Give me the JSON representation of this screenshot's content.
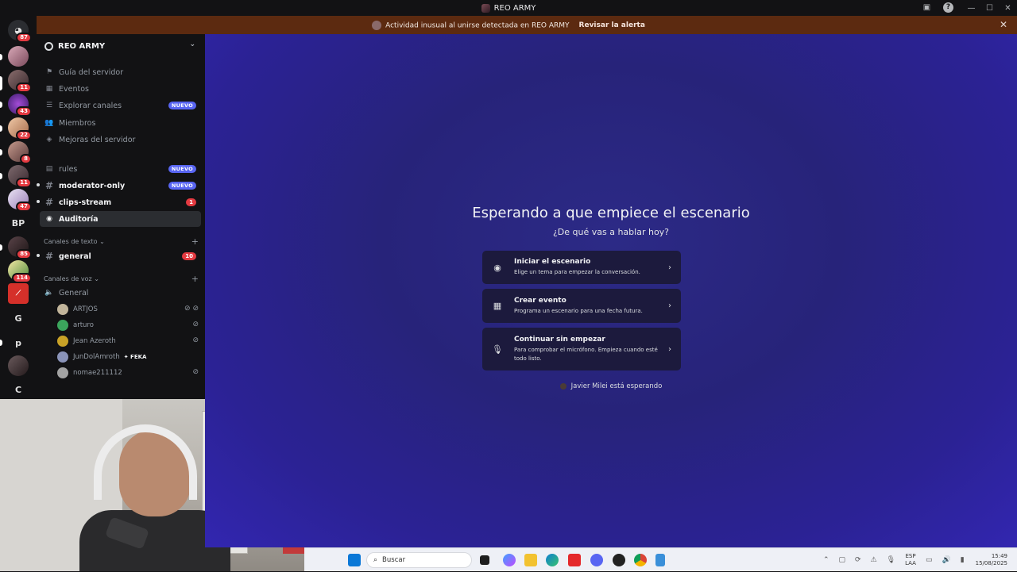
{
  "window": {
    "title": "REO ARMY"
  },
  "alert": {
    "message": "Actividad inusual al unirse detectada en REO ARMY",
    "action": "Revisar la alerta"
  },
  "guilds": [
    {
      "badge": "87"
    },
    {
      "badge": ""
    },
    {
      "badge": "11"
    },
    {
      "badge": "43"
    },
    {
      "badge": "22"
    },
    {
      "badge": "8"
    },
    {
      "badge": "11"
    },
    {
      "badge": "47"
    },
    {
      "label": "BP",
      "badge": ""
    },
    {
      "badge": "85"
    },
    {
      "badge": "114"
    },
    {
      "badge": ""
    },
    {
      "label": "G",
      "badge": ""
    },
    {
      "label": "p",
      "badge": ""
    },
    {
      "badge": ""
    },
    {
      "label": "C",
      "badge": ""
    }
  ],
  "server": {
    "name": "REO ARMY",
    "menu": [
      {
        "label": "Guía del servidor",
        "icon": "signpost-icon"
      },
      {
        "label": "Eventos",
        "icon": "calendar-icon"
      },
      {
        "label": "Explorar canales",
        "icon": "browse-icon",
        "badge": "NUEVO"
      },
      {
        "label": "Miembros",
        "icon": "members-icon"
      },
      {
        "label": "Mejoras del servidor",
        "icon": "boost-icon"
      }
    ],
    "channels": [
      {
        "label": "rules",
        "badge": "NUEVO"
      },
      {
        "label": "moderator-only",
        "badge": "NUEVO"
      },
      {
        "label": "clips-stream",
        "count": "1"
      },
      {
        "label": "Auditoría"
      }
    ],
    "text_category": "Canales de texto",
    "text_channels": [
      {
        "label": "general",
        "count": "10"
      }
    ],
    "voice_category": "Canales de voz",
    "voice_channel": "General",
    "voice_users": [
      {
        "name": "ARTJOS",
        "color": "#c2b59b"
      },
      {
        "name": "arturo",
        "color": "#3ba55c"
      },
      {
        "name": "Jean Azeroth",
        "color": "#c9a227"
      },
      {
        "name": "JunDolAmroth",
        "color": "#8a93b8",
        "tag": "FEKA"
      },
      {
        "name": "nomae211112",
        "color": "#a3a3a3"
      }
    ]
  },
  "stage": {
    "title": "Esperando a que empiece el escenario",
    "subtitle": "¿De qué vas a hablar hoy?",
    "options": [
      {
        "title": "Iniciar el escenario",
        "desc": "Elige un tema para empezar la conversación.",
        "icon": "stage-icon"
      },
      {
        "title": "Crear evento",
        "desc": "Programa un escenario para una fecha futura.",
        "icon": "calendar-icon"
      },
      {
        "title": "Continuar sin empezar",
        "desc": "Para comprobar el micrófono. Empieza cuando esté todo listo.",
        "icon": "microphone-icon"
      }
    ],
    "waiting": "Javier Milei está esperando"
  },
  "taskbar": {
    "search": "Buscar",
    "lang_top": "ESP",
    "lang_bottom": "LAA",
    "time": "15:49",
    "date": "15/08/2025"
  }
}
